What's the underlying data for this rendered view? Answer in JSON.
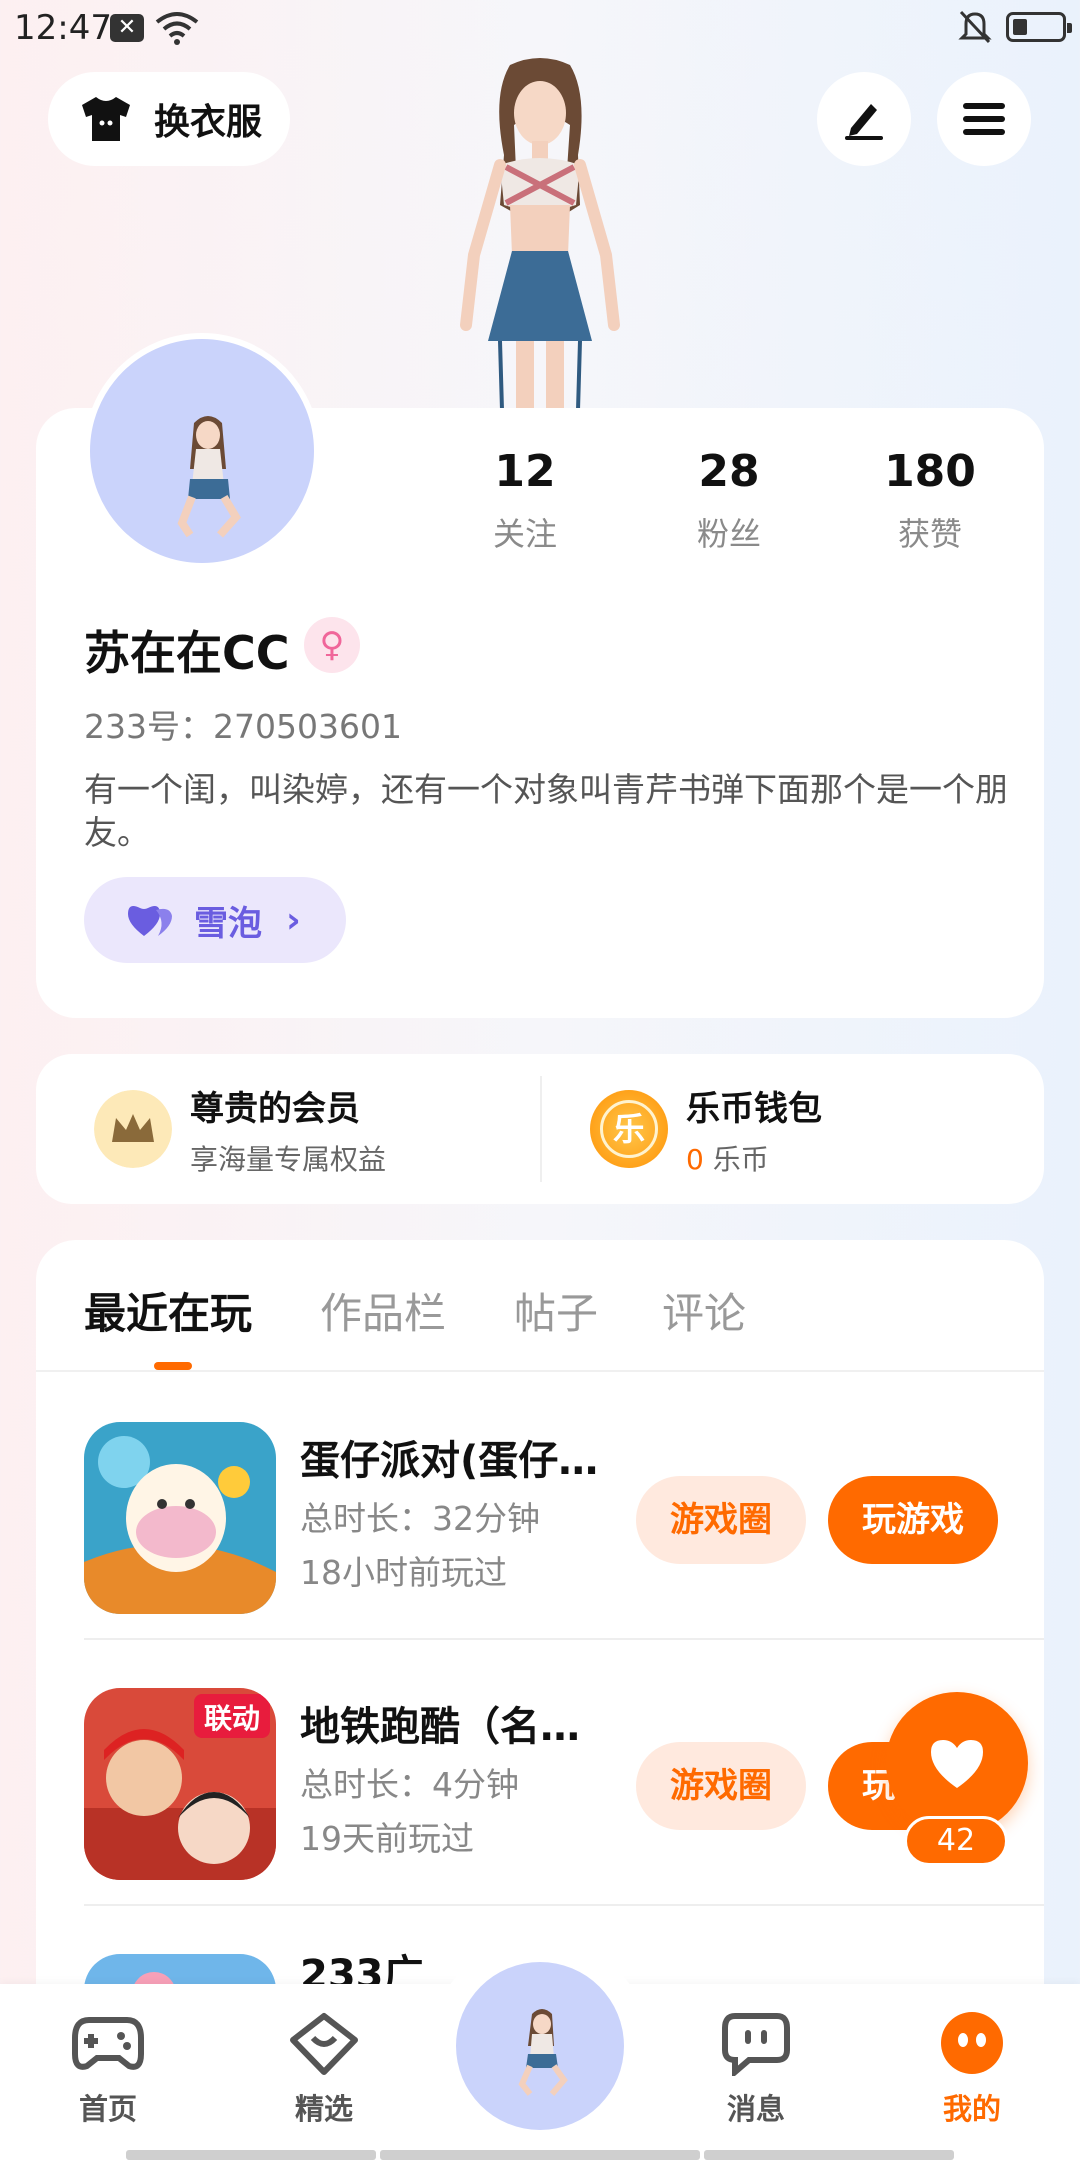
{
  "status_bar": {
    "time": "12:47"
  },
  "header": {
    "outfit_label": "换衣服",
    "icons": [
      "shirt-icon",
      "pen-icon",
      "menu-icon"
    ]
  },
  "profile": {
    "stats": [
      {
        "value": "12",
        "label": "关注"
      },
      {
        "value": "28",
        "label": "粉丝"
      },
      {
        "value": "180",
        "label": "获赞"
      }
    ],
    "name": "苏在在CC",
    "gender_symbol": "♀",
    "id_text": "233号：270503601",
    "bio": "有一个闺，叫染婷，还有一个对象叫青芹书弹下面那个是一个朋友。",
    "tag_label": "雪泡",
    "tag_chevron": "›"
  },
  "member": {
    "vip_title": "尊贵的会员",
    "vip_sub": "享海量专属权益",
    "wallet_title": "乐币钱包",
    "wallet_icon_text": "乐",
    "wallet_count": "0",
    "wallet_unit": " 乐币"
  },
  "recent": {
    "tabs": [
      "最近在玩",
      "作品栏",
      "帖子",
      "评论"
    ],
    "games": [
      {
        "name": "蛋仔派对(蛋仔…",
        "duration": "总时长：32分钟",
        "last_played": "18小时前玩过",
        "circle_label": "游戏圈",
        "play_label": "玩游戏"
      },
      {
        "name": "地铁跑酷（名…",
        "duration": "总时长：4分钟",
        "last_played": "19天前玩过",
        "circle_label": "游戏圈",
        "play_label": "玩游戏"
      }
    ],
    "partial_text": "233广"
  },
  "like_fab": {
    "count": "42"
  },
  "bottom_nav": {
    "items": [
      {
        "label": "首页"
      },
      {
        "label": "精选"
      },
      {
        "label": "消息"
      },
      {
        "label": "我的"
      }
    ]
  },
  "colors": {
    "accent": "#ff6a00",
    "tag_purple": "#6a5de0",
    "avatar_bg": "#cad3fb"
  }
}
